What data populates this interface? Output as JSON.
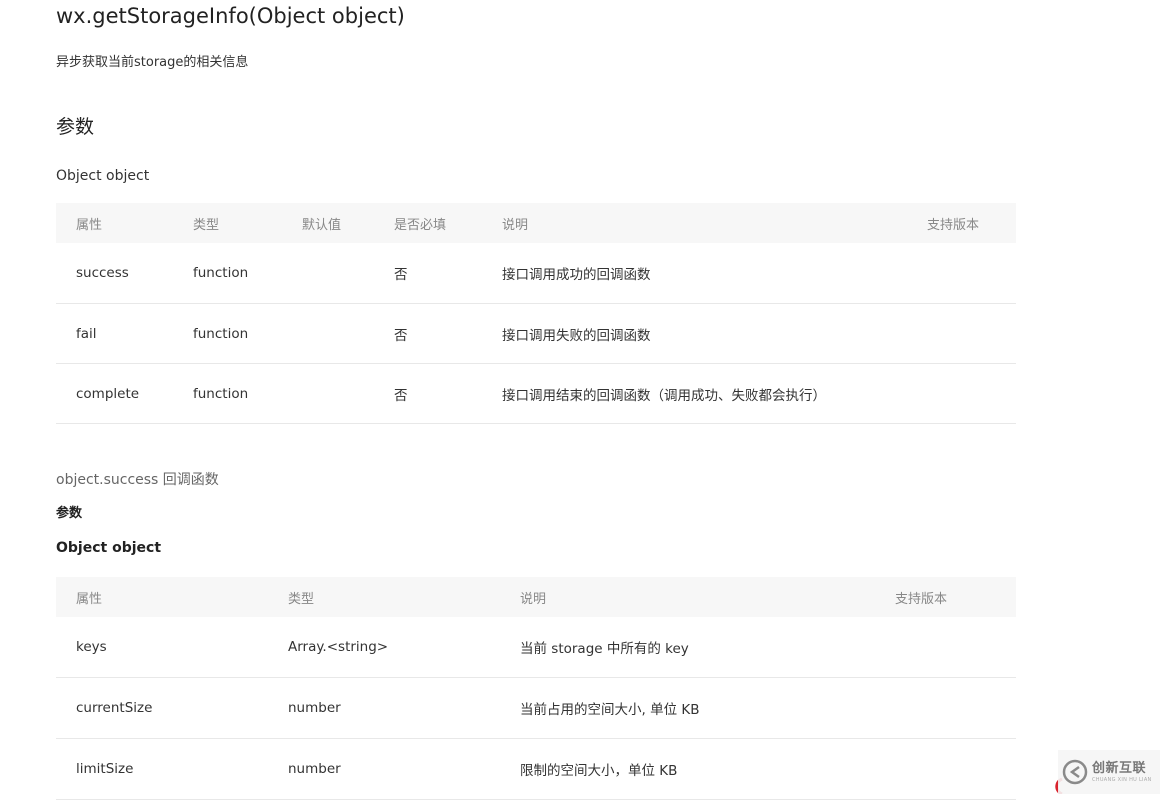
{
  "api": {
    "title": "wx.getStorageInfo(Object object)",
    "description": "异步获取当前storage的相关信息"
  },
  "params_section": {
    "heading": "参数",
    "object_heading": "Object object",
    "columns": [
      "属性",
      "类型",
      "默认值",
      "是否必填",
      "说明",
      "支持版本"
    ],
    "rows": [
      {
        "prop": "success",
        "type": "function",
        "default": "",
        "required": "否",
        "desc": "接口调用成功的回调函数",
        "version": ""
      },
      {
        "prop": "fail",
        "type": "function",
        "default": "",
        "required": "否",
        "desc": "接口调用失败的回调函数",
        "version": ""
      },
      {
        "prop": "complete",
        "type": "function",
        "default": "",
        "required": "否",
        "desc": "接口调用结束的回调函数（调用成功、失败都会执行）",
        "version": ""
      }
    ]
  },
  "success_section": {
    "heading": "object.success 回调函数",
    "params_heading": "参数",
    "object_heading": "Object object",
    "columns": [
      "属性",
      "类型",
      "说明",
      "支持版本"
    ],
    "rows": [
      {
        "prop": "keys",
        "type": "Array.<string>",
        "desc": "当前 storage 中所有的 key",
        "version": ""
      },
      {
        "prop": "currentSize",
        "type": "number",
        "desc": "当前占用的空间大小, 单位 KB",
        "version": ""
      },
      {
        "prop": "limitSize",
        "type": "number",
        "desc": "限制的空间大小，单位 KB",
        "version": ""
      }
    ]
  },
  "watermark": {
    "text": "创新互联",
    "subtext": "CHUANG XIN HU LIAN",
    "logo_icon": "cx-logo-icon",
    "accent_color": "#d9232d"
  }
}
